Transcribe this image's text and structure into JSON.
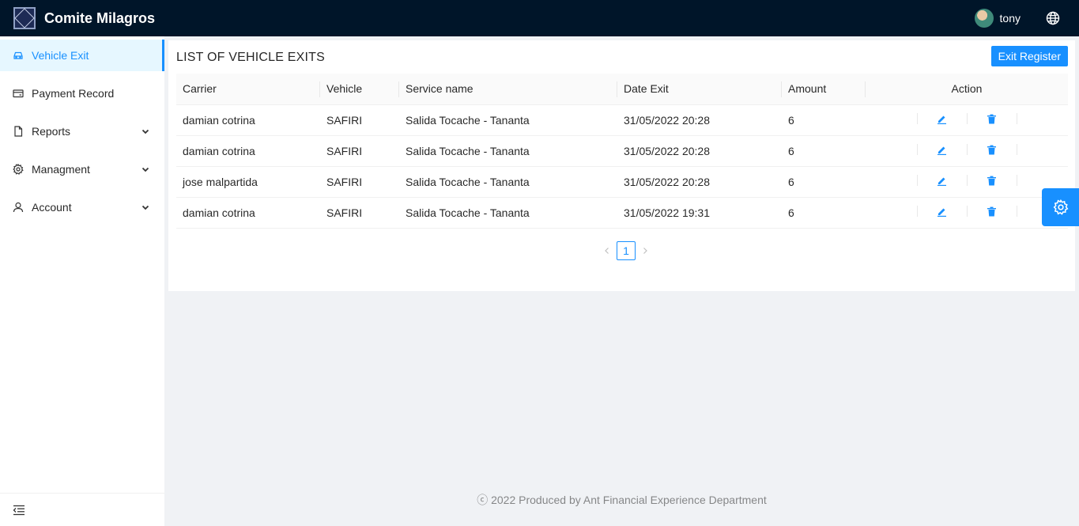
{
  "app": {
    "title": "Comite Milagros"
  },
  "header": {
    "username": "tony"
  },
  "sidebar": {
    "items": [
      {
        "label": "Vehicle Exit",
        "icon": "car-icon",
        "active": true
      },
      {
        "label": "Payment Record",
        "icon": "credit-card-icon"
      },
      {
        "label": "Reports",
        "icon": "file-icon",
        "has_children": true
      },
      {
        "label": "Managment",
        "icon": "gear-icon",
        "has_children": true
      },
      {
        "label": "Account",
        "icon": "user-icon",
        "has_children": true
      }
    ]
  },
  "main": {
    "title": "LIST OF VEHICLE EXITS",
    "exit_button_label": "Exit Register",
    "table": {
      "columns": [
        "Carrier",
        "Vehicle",
        "Service name",
        "Date Exit",
        "Amount",
        "Action"
      ],
      "rows": [
        {
          "carrier": "damian cotrina",
          "vehicle": "SAFIRI",
          "service": "Salida Tocache - Tananta",
          "date": "31/05/2022 20:28",
          "amount": "6"
        },
        {
          "carrier": "damian cotrina",
          "vehicle": "SAFIRI",
          "service": "Salida Tocache - Tananta",
          "date": "31/05/2022 20:28",
          "amount": "6"
        },
        {
          "carrier": "jose malpartida",
          "vehicle": "SAFIRI",
          "service": "Salida Tocache - Tananta",
          "date": "31/05/2022 20:28",
          "amount": "6"
        },
        {
          "carrier": "damian cotrina",
          "vehicle": "SAFIRI",
          "service": "Salida Tocache - Tananta",
          "date": "31/05/2022 19:31",
          "amount": "6"
        }
      ]
    },
    "pagination": {
      "current_page": "1"
    }
  },
  "footer": {
    "text": "ⓒ 2022 Produced by Ant Financial Experience Department"
  },
  "colors": {
    "primary": "#1890ff",
    "header_bg": "#001529"
  }
}
